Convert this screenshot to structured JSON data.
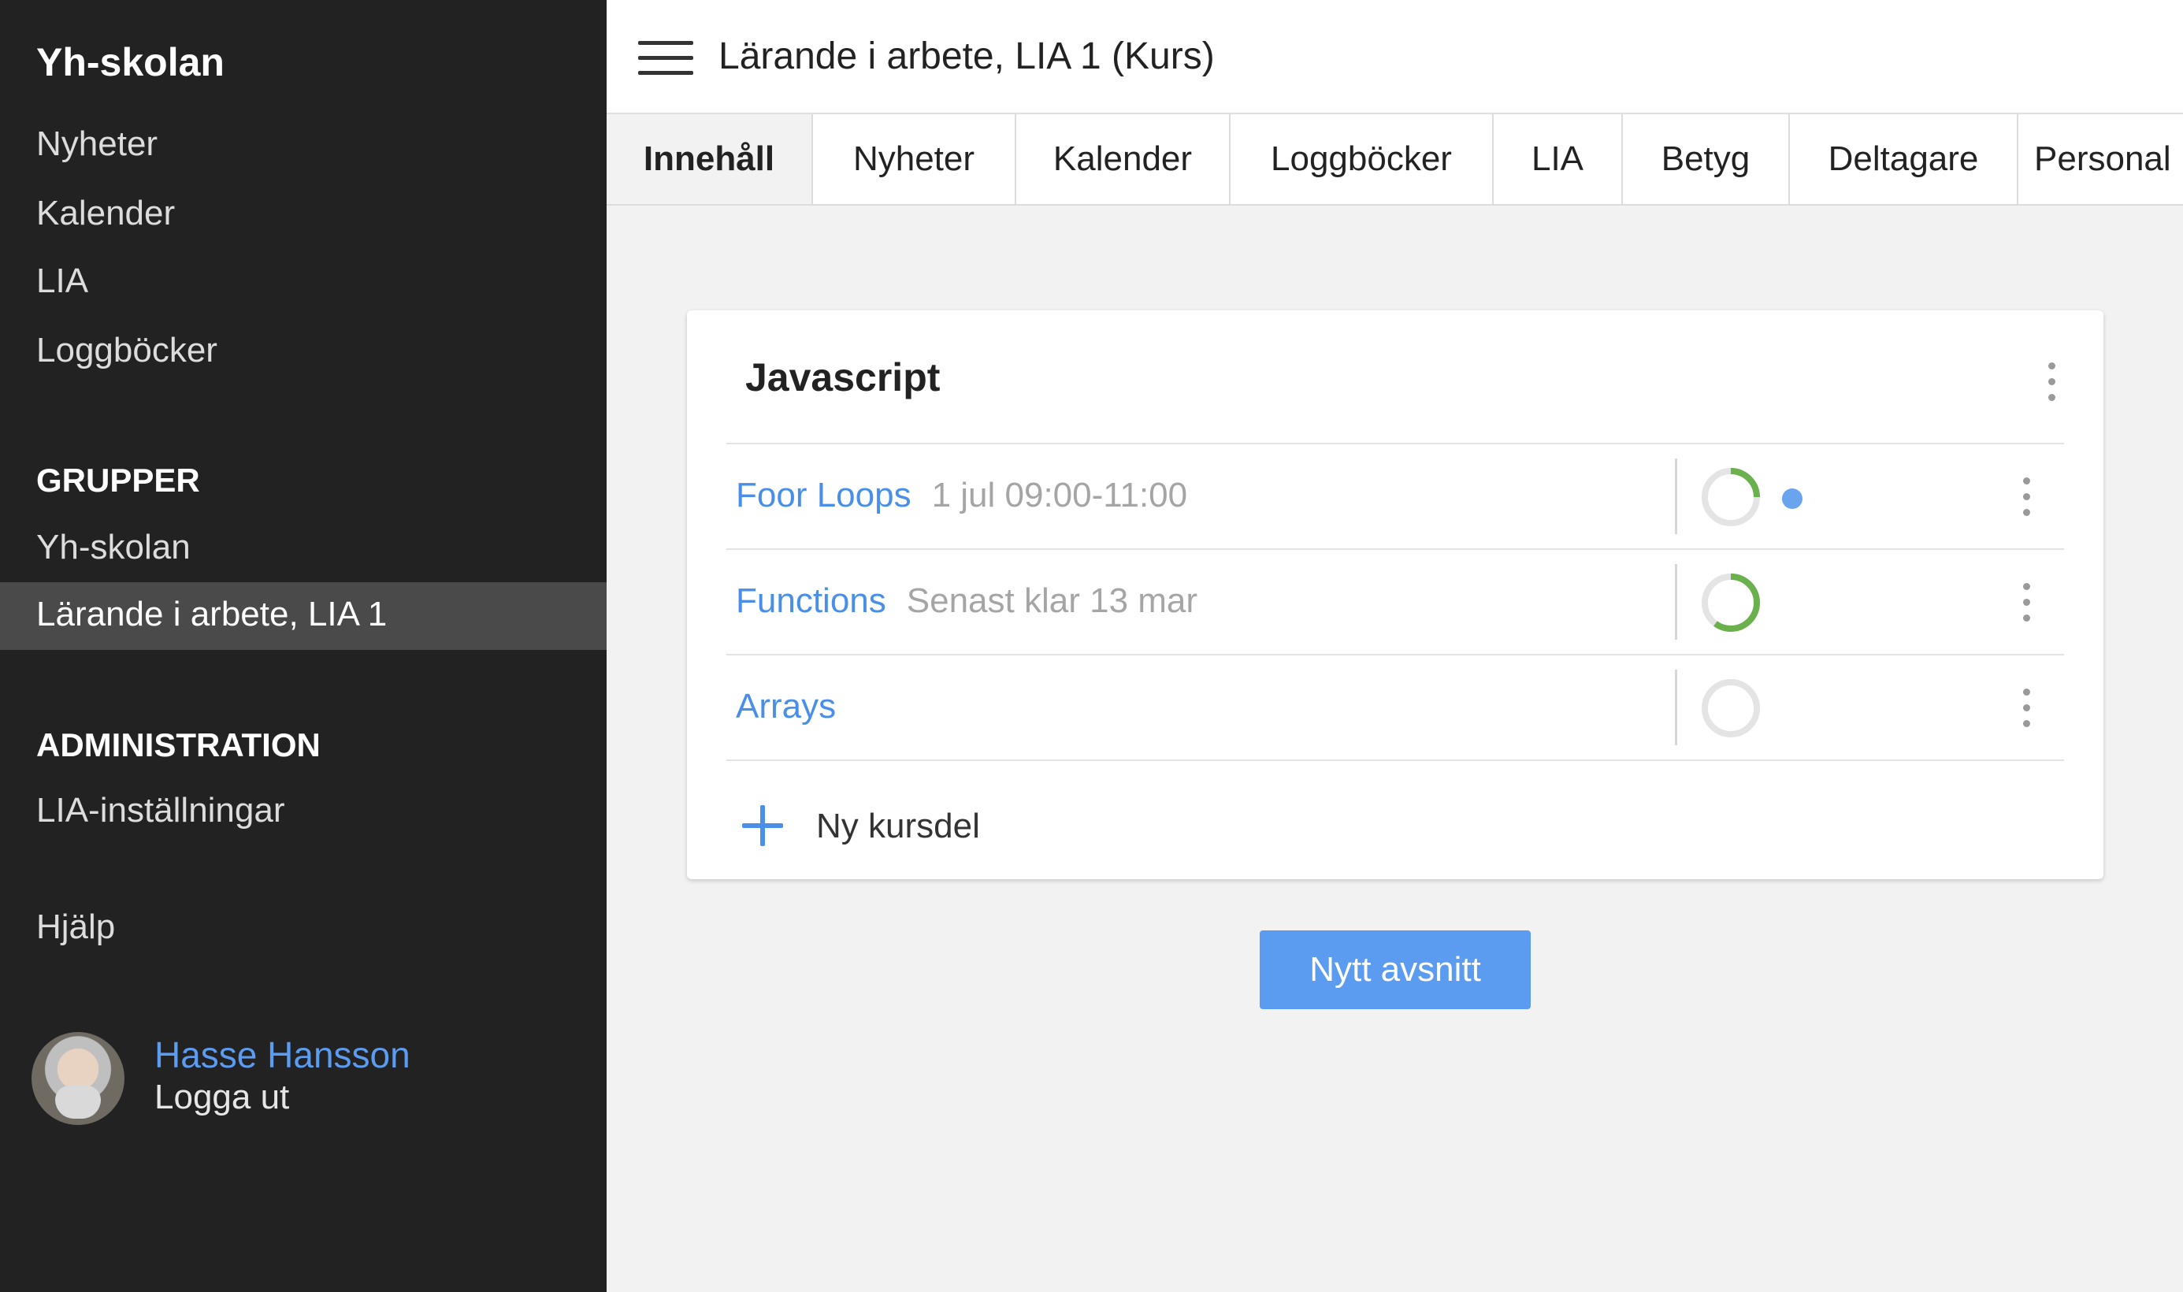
{
  "sidebar": {
    "brand": "Yh-skolan",
    "items": [
      "Nyheter",
      "Kalender",
      "LIA",
      "Loggböcker"
    ],
    "groups_heading": "GRUPPER",
    "groups": [
      "Yh-skolan",
      "Lärande i arbete, LIA 1"
    ],
    "active_group": "Lärande i arbete, LIA 1",
    "admin_heading": "ADMINISTRATION",
    "admin_items": [
      "LIA-inställningar"
    ],
    "help": "Hjälp",
    "user": {
      "name": "Hasse Hansson",
      "logout": "Logga ut"
    }
  },
  "header": {
    "title": "Lärande i arbete, LIA 1 (Kurs)"
  },
  "tabs": [
    {
      "label": "Innehåll",
      "active": true
    },
    {
      "label": "Nyheter"
    },
    {
      "label": "Kalender"
    },
    {
      "label": "Loggböcker"
    },
    {
      "label": "LIA"
    },
    {
      "label": "Betyg"
    },
    {
      "label": "Deltagare"
    },
    {
      "label": "Personal"
    }
  ],
  "section": {
    "title": "Javascript",
    "parts": [
      {
        "name": "Foor Loops",
        "meta": "1 jul 09:00-11:00",
        "progress": 0.25,
        "has_dot": true
      },
      {
        "name": "Functions",
        "meta": "Senast klar 13 mar",
        "progress": 0.6,
        "has_dot": false
      },
      {
        "name": "Arrays",
        "meta": "",
        "progress": 0,
        "has_dot": false
      }
    ],
    "add_label": "Ny kursdel"
  },
  "new_section_button": "Nytt avsnitt",
  "colors": {
    "accent": "#5b9bf0",
    "link": "#4a8fe7",
    "progress": "#6ab04c",
    "sidebar": "#222222"
  }
}
